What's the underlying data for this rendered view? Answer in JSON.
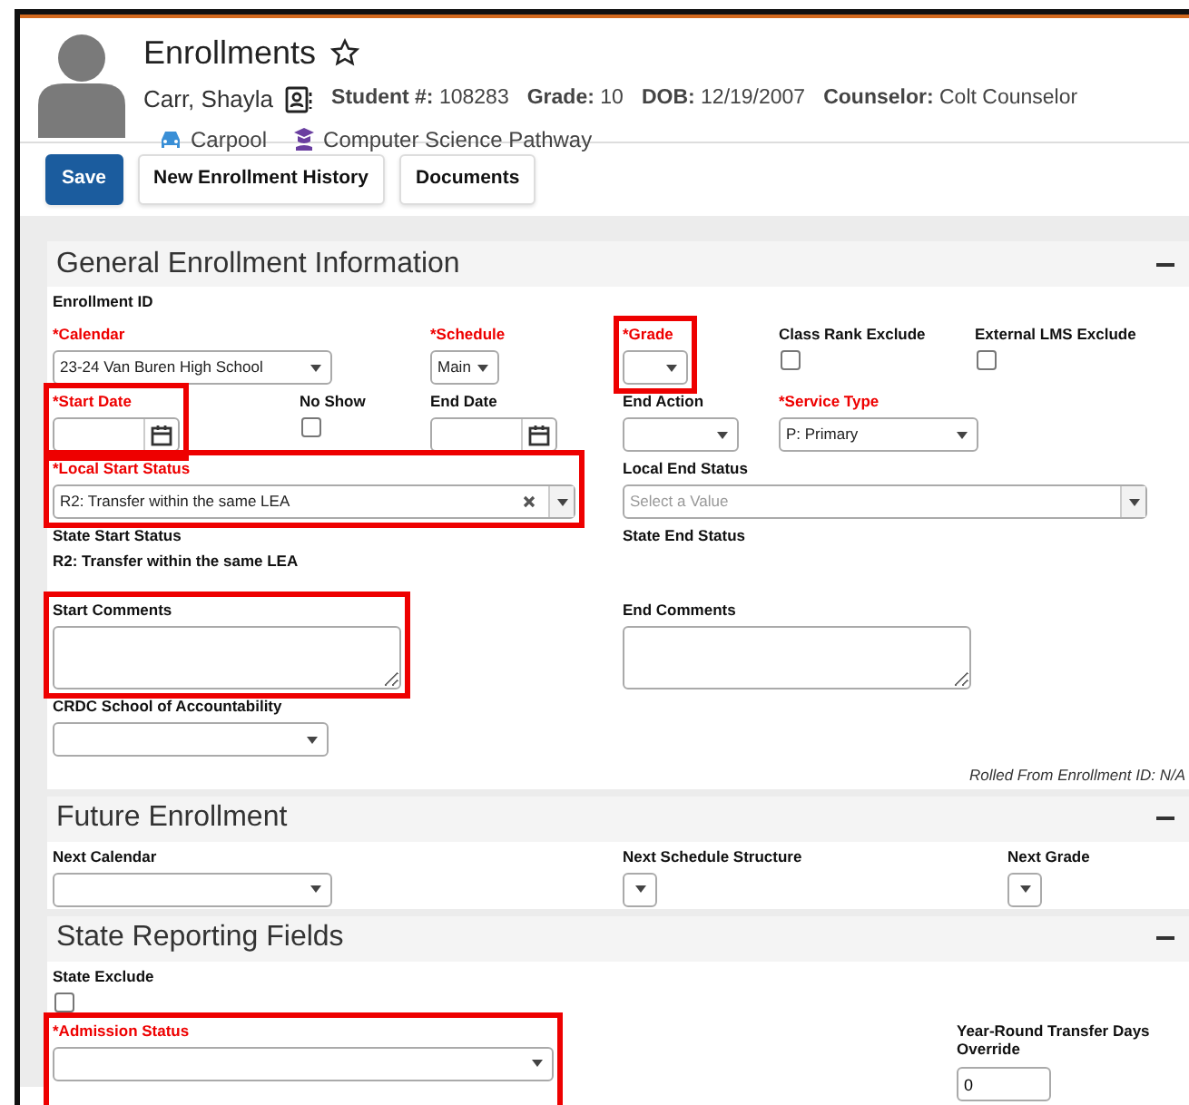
{
  "header": {
    "title": "Enrollments",
    "student_name": "Carr, Shayla",
    "facts": [
      {
        "label": "Student #:",
        "value": "108283"
      },
      {
        "label": "Grade:",
        "value": "10"
      },
      {
        "label": "DOB:",
        "value": "12/19/2007"
      },
      {
        "label": "Counselor:",
        "value": "Colt Counselor"
      }
    ],
    "tags": [
      {
        "kind": "car",
        "label": "Carpool"
      },
      {
        "kind": "pathway",
        "label": "Computer Science Pathway"
      }
    ]
  },
  "toolbar": [
    {
      "label": "Save",
      "primary": true
    },
    {
      "label": "New Enrollment History",
      "primary": false
    },
    {
      "label": "Documents",
      "primary": false
    }
  ],
  "sections": [
    {
      "title": "General Enrollment Information",
      "fields": [
        {
          "kind": "label",
          "label": "Enrollment ID",
          "required": false,
          "highlighted": false
        },
        {
          "kind": "select",
          "label": "*Calendar",
          "required": true,
          "highlighted": false,
          "value": "23-24 Van Buren High School"
        },
        {
          "kind": "select",
          "label": "*Schedule",
          "required": true,
          "highlighted": false,
          "value": "Main"
        },
        {
          "kind": "select",
          "label": "*Grade",
          "required": true,
          "highlighted": true
        },
        {
          "kind": "checkbox",
          "label": "Class Rank Exclude",
          "required": false,
          "highlighted": false,
          "checked": false
        },
        {
          "kind": "checkbox",
          "label": "External LMS Exclude",
          "required": false,
          "highlighted": false,
          "checked": false
        },
        {
          "kind": "date",
          "label": "*Start Date",
          "required": true,
          "highlighted": true
        },
        {
          "kind": "checkbox",
          "label": "No Show",
          "required": false,
          "highlighted": false,
          "checked": false
        },
        {
          "kind": "date",
          "label": "End Date",
          "required": false,
          "highlighted": false
        },
        {
          "kind": "select",
          "label": "End Action",
          "required": false,
          "highlighted": false
        },
        {
          "kind": "select",
          "label": "*Service Type",
          "required": true,
          "highlighted": false,
          "value": "P: Primary"
        },
        {
          "kind": "combo",
          "label": "*Local Start Status",
          "required": true,
          "highlighted": true,
          "value": "R2: Transfer within the same LEA",
          "clearable": true
        },
        {
          "kind": "combo",
          "label": "Local End Status",
          "required": false,
          "highlighted": false,
          "placeholder": "Select a Value",
          "clearable": false
        },
        {
          "kind": "static",
          "label": "State Start Status",
          "required": false,
          "highlighted": false,
          "value": "R2: Transfer within the same LEA"
        },
        {
          "kind": "static",
          "label": "State End Status",
          "required": false,
          "highlighted": false
        },
        {
          "kind": "textarea",
          "label": "Start Comments",
          "required": false,
          "highlighted": true
        },
        {
          "kind": "textarea",
          "label": "End Comments",
          "required": false,
          "highlighted": false
        },
        {
          "kind": "select",
          "label": "CRDC School of Accountability",
          "required": false,
          "highlighted": false
        }
      ],
      "note": "Rolled From Enrollment ID: N/A"
    },
    {
      "title": "Future Enrollment",
      "fields": [
        {
          "kind": "select",
          "label": "Next Calendar",
          "required": false,
          "highlighted": false
        },
        {
          "kind": "select",
          "label": "Next Schedule Structure",
          "required": false,
          "highlighted": false
        },
        {
          "kind": "select",
          "label": "Next Grade",
          "required": false,
          "highlighted": false
        }
      ]
    },
    {
      "title": "State Reporting Fields",
      "fields": [
        {
          "kind": "checkbox",
          "label": "State Exclude",
          "required": false,
          "highlighted": false,
          "checked": false
        },
        {
          "kind": "select",
          "label": "*Admission Status",
          "required": true,
          "highlighted": true
        },
        {
          "kind": "text",
          "label": "Year-Round Transfer Days Override",
          "required": false,
          "highlighted": false,
          "value": "0"
        }
      ]
    }
  ]
}
